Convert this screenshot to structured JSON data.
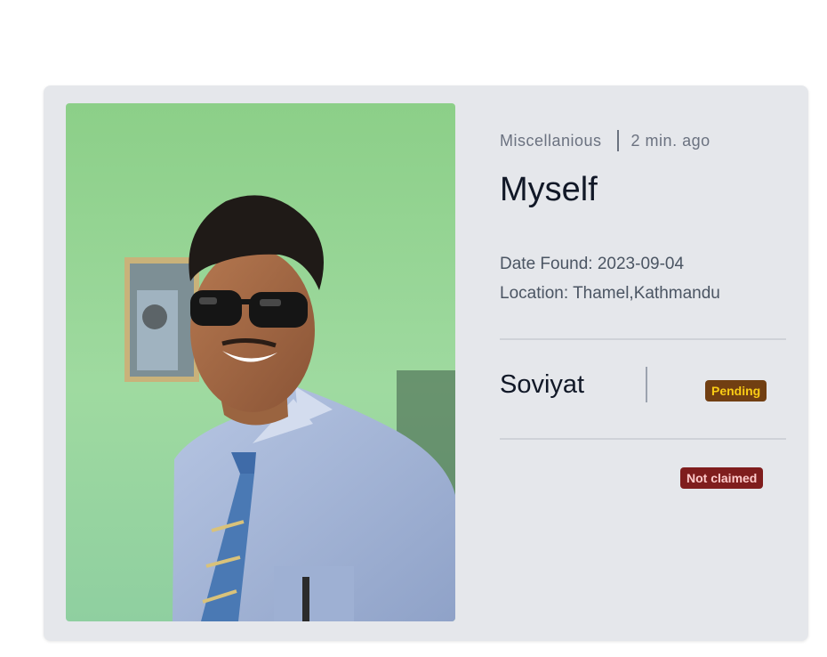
{
  "item": {
    "category": "Miscellanious",
    "posted": "2 min. ago",
    "title": "Myself",
    "date_found_label": "Date Found:",
    "date_found": "2023-09-04",
    "location_label": "Location:",
    "location": "Thamel,Kathmandu",
    "owner": "Soviyat",
    "status": "Pending",
    "claim_status": "Not claimed"
  },
  "colors": {
    "card_background": "#e5e7eb",
    "pending_bg": "#713f12",
    "pending_text": "#facc15",
    "claim_bg": "#7f1d1d",
    "claim_text": "#fecaca"
  },
  "image": {
    "subject": "photo-of-smiling-man-in-sunglasses-and-tie"
  }
}
